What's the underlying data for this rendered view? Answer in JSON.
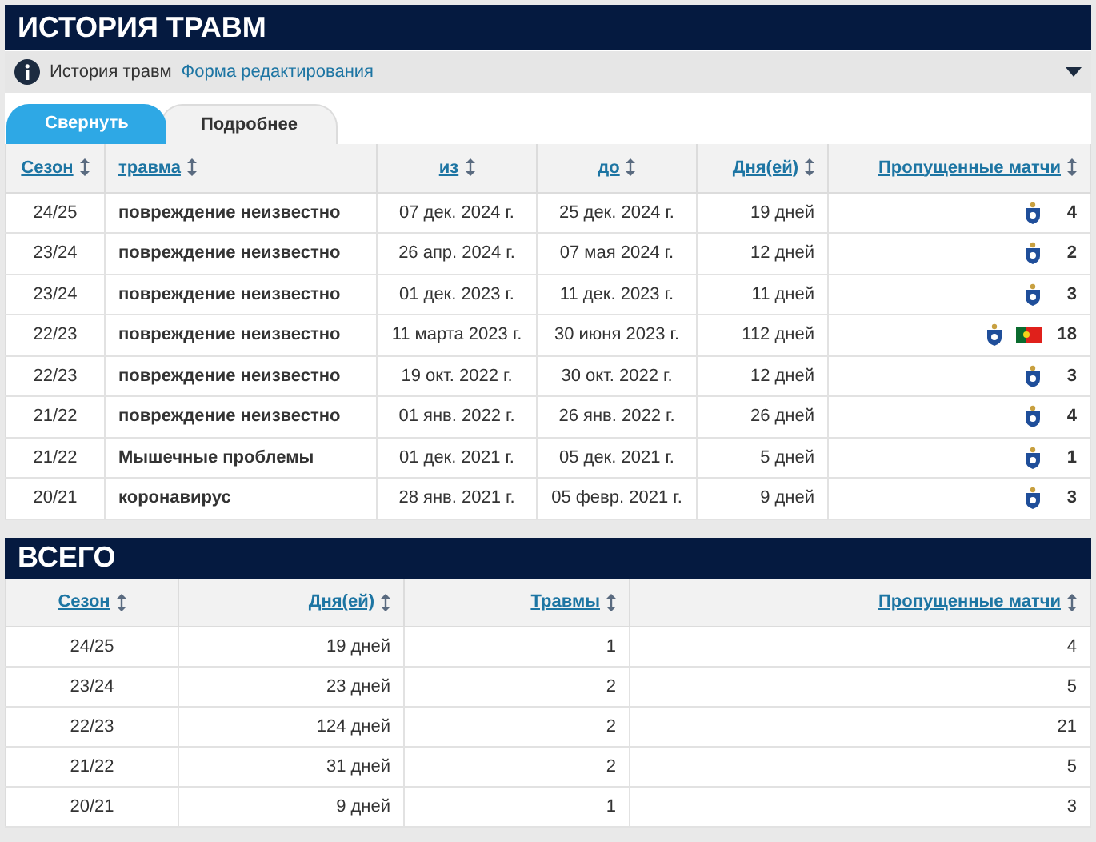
{
  "title": "ИСТОРИЯ ТРАВМ",
  "info": {
    "text": "История травм",
    "link": "Форма редактирования"
  },
  "tabs": [
    {
      "label": "Свернуть",
      "selected": true
    },
    {
      "label": "Подробнее",
      "selected": false
    }
  ],
  "injuries": {
    "columns": [
      "Сезон",
      "травма",
      "из",
      "до",
      "Дня(ей)",
      "Пропущенные матчи"
    ],
    "rows": [
      {
        "season": "24/25",
        "injury": "повреждение неизвестно",
        "from": "07 дек. 2024 г.",
        "until": "25 дек. 2024 г.",
        "days": "19 дней",
        "icons": [
          {
            "kind": "club"
          }
        ],
        "games": "4"
      },
      {
        "season": "23/24",
        "injury": "повреждение неизвестно",
        "from": "26 апр. 2024 г.",
        "until": "07 мая 2024 г.",
        "days": "12 дней",
        "icons": [
          {
            "kind": "club"
          }
        ],
        "games": "2"
      },
      {
        "season": "23/24",
        "injury": "повреждение неизвестно",
        "from": "01 дек. 2023 г.",
        "until": "11 дек. 2023 г.",
        "days": "11 дней",
        "icons": [
          {
            "kind": "club"
          }
        ],
        "games": "3"
      },
      {
        "season": "22/23",
        "injury": "повреждение неизвестно",
        "from": "11 марта 2023 г.",
        "until": "30 июня 2023 г.",
        "days": "112 дней",
        "icons": [
          {
            "kind": "club"
          },
          {
            "kind": "flag"
          }
        ],
        "games": "18"
      },
      {
        "season": "22/23",
        "injury": "повреждение неизвестно",
        "from": "19 окт. 2022 г.",
        "until": "30 окт. 2022 г.",
        "days": "12 дней",
        "icons": [
          {
            "kind": "club"
          }
        ],
        "games": "3"
      },
      {
        "season": "21/22",
        "injury": "повреждение неизвестно",
        "from": "01 янв. 2022 г.",
        "until": "26 янв. 2022 г.",
        "days": "26 дней",
        "icons": [
          {
            "kind": "club"
          }
        ],
        "games": "4"
      },
      {
        "season": "21/22",
        "injury": "Мышечные проблемы",
        "from": "01 дек. 2021 г.",
        "until": "05 дек. 2021 г.",
        "days": "5 дней",
        "icons": [
          {
            "kind": "club"
          }
        ],
        "games": "1"
      },
      {
        "season": "20/21",
        "injury": "коронавирус",
        "from": "28 янв. 2021 г.",
        "until": "05 февр. 2021 г.",
        "days": "9 дней",
        "icons": [
          {
            "kind": "club"
          }
        ],
        "games": "3"
      }
    ]
  },
  "totals": {
    "title": "ВСЕГО",
    "columns": [
      "Сезон",
      "Дня(ей)",
      "Травмы",
      "Пропущенные матчи"
    ],
    "rows": [
      [
        "24/25",
        "19 дней",
        "1",
        "4"
      ],
      [
        "23/24",
        "23 дней",
        "2",
        "5"
      ],
      [
        "22/23",
        "124 дней",
        "2",
        "21"
      ],
      [
        "21/22",
        "31 дней",
        "2",
        "5"
      ],
      [
        "20/21",
        "9 дней",
        "1",
        "3"
      ]
    ]
  }
}
